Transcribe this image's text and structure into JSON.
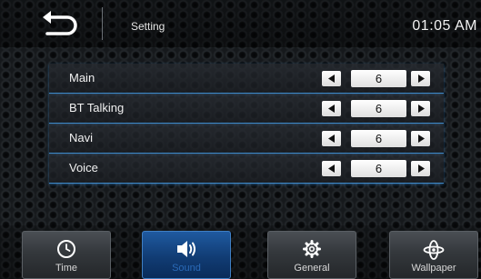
{
  "header": {
    "title": "Setting",
    "clock": "01:05 AM"
  },
  "icons": {
    "back": "back-arrow-icon",
    "left": "left-arrow-icon",
    "right": "right-arrow-icon",
    "time": "clock-icon",
    "sound": "speaker-icon",
    "general": "gear-icon",
    "wallpaper": "wallpaper-icon"
  },
  "colors": {
    "accent": "#2a6ab8",
    "row_border": "#3e88c8"
  },
  "settings": {
    "rows": [
      {
        "label": "Main",
        "value": "6"
      },
      {
        "label": "BT Talking",
        "value": "6"
      },
      {
        "label": "Navi",
        "value": "6"
      },
      {
        "label": "Voice",
        "value": "6"
      }
    ]
  },
  "nav": {
    "active": "Sound",
    "items": [
      {
        "label": "Time"
      },
      {
        "label": "Sound"
      },
      {
        "label": "General"
      },
      {
        "label": "Wallpaper"
      }
    ]
  }
}
